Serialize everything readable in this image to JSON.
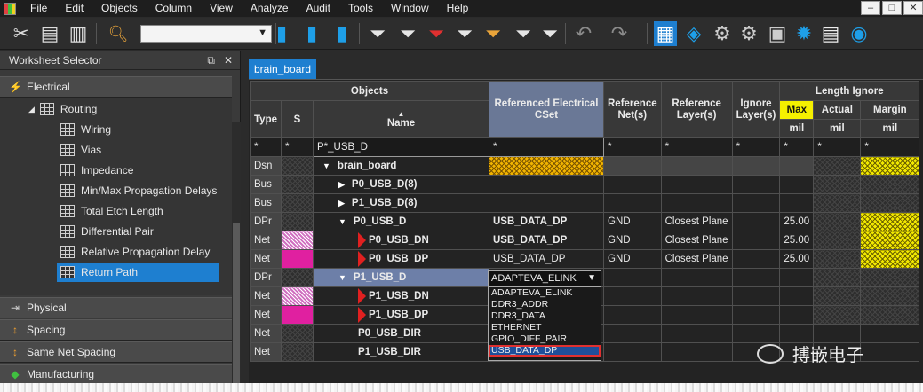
{
  "menu": [
    "File",
    "Edit",
    "Objects",
    "Column",
    "View",
    "Analyze",
    "Audit",
    "Tools",
    "Window",
    "Help"
  ],
  "window_controls": [
    "–",
    "□",
    "✕"
  ],
  "worksheet_selector": {
    "title": "Worksheet Selector",
    "categories": [
      "Electrical",
      "Physical",
      "Spacing",
      "Same Net Spacing",
      "Manufacturing"
    ],
    "routing_label": "Routing",
    "items": [
      "Wiring",
      "Vias",
      "Impedance",
      "Min/Max Propagation Delays",
      "Total Etch Length",
      "Differential Pair",
      "Relative Propagation Delay",
      "Return Path"
    ],
    "selected_item": "Return Path"
  },
  "tab_label": "brain_board",
  "table": {
    "headers": {
      "objects": "Objects",
      "type": "Type",
      "s": "S",
      "name": "Name",
      "ref_cset": "Referenced Electrical CSet",
      "ref_nets": "Reference Net(s)",
      "ref_layers": "Reference Layer(s)",
      "ignore_layers": "Ignore Layer(s)",
      "length_ignore": "Length Ignore",
      "max": "Max",
      "actual": "Actual",
      "margin": "Margin",
      "unit": "mil"
    },
    "filter": {
      "star": "*",
      "name": "P*_USB_D"
    },
    "rows": [
      {
        "type": "Dsn",
        "name": "brain_board",
        "cset": "",
        "nets": "",
        "layers": "",
        "max": ""
      },
      {
        "type": "Bus",
        "name": "P0_USB_D(8)",
        "cset": "",
        "nets": "",
        "layers": "",
        "max": ""
      },
      {
        "type": "Bus",
        "name": "P1_USB_D(8)",
        "cset": "",
        "nets": "",
        "layers": "",
        "max": ""
      },
      {
        "type": "DPr",
        "name": "P0_USB_D",
        "cset": "USB_DATA_DP",
        "nets": "GND",
        "layers": "Closest Plane",
        "max": "25.00"
      },
      {
        "type": "Net",
        "name": "P0_USB_DN",
        "cset": "USB_DATA_DP",
        "nets": "GND",
        "layers": "Closest Plane",
        "max": "25.00"
      },
      {
        "type": "Net",
        "name": "P0_USB_DP",
        "cset": "USB_DATA_DP",
        "nets": "GND",
        "layers": "Closest Plane",
        "max": "25.00"
      },
      {
        "type": "DPr",
        "name": "P1_USB_D",
        "cset": "",
        "nets": "",
        "layers": "",
        "max": ""
      },
      {
        "type": "Net",
        "name": "P1_USB_DN",
        "cset": "",
        "nets": "",
        "layers": "",
        "max": ""
      },
      {
        "type": "Net",
        "name": "P1_USB_DP",
        "cset": "",
        "nets": "",
        "layers": "",
        "max": ""
      },
      {
        "type": "Net",
        "name": "P0_USB_DIR",
        "cset": "",
        "nets": "",
        "layers": "",
        "max": ""
      },
      {
        "type": "Net",
        "name": "P1_USB_DIR",
        "cset": "",
        "nets": "",
        "layers": "",
        "max": ""
      }
    ]
  },
  "dropdown": {
    "value": "ADAPTEVA_ELINK",
    "options": [
      "ADAPTEVA_ELINK",
      "DDR3_ADDR",
      "DDR3_DATA",
      "ETHERNET",
      "GPIO_DIFF_PAIR",
      "USB_DATA_DP"
    ],
    "highlighted": "USB_DATA_DP"
  },
  "watermark": "搏嵌电子",
  "colors": {
    "accent": "#1e7fd0",
    "cset_header": "#6a7896",
    "max_header": "#f5f000",
    "cyan_text": "#29b6f6"
  }
}
